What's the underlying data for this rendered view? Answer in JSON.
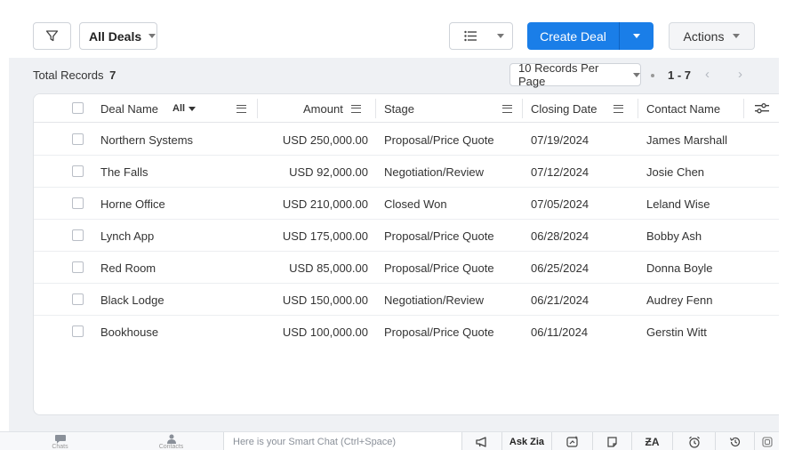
{
  "toolbar": {
    "filter_icon": "filter-icon",
    "view_label": "All Deals",
    "list_view_icon": "list-view-icon",
    "create_label": "Create Deal",
    "actions_label": "Actions"
  },
  "records": {
    "total_label": "Total Records",
    "total_count": "7",
    "per_page": "10 Records Per Page",
    "range": "1 - 7",
    "prev": "‹",
    "next": "›"
  },
  "table": {
    "columns": {
      "deal_name": "Deal Name",
      "deal_filter": "All",
      "amount": "Amount",
      "stage": "Stage",
      "closing_date": "Closing Date",
      "contact_name": "Contact Name"
    },
    "rows": [
      {
        "deal": "Northern Systems",
        "amount": "USD 250,000.00",
        "stage": "Proposal/Price Quote",
        "date": "07/19/2024",
        "contact": "James Marshall"
      },
      {
        "deal": "The Falls",
        "amount": "USD 92,000.00",
        "stage": "Negotiation/Review",
        "date": "07/12/2024",
        "contact": "Josie Chen"
      },
      {
        "deal": "Horne Office",
        "amount": "USD 210,000.00",
        "stage": "Closed Won",
        "date": "07/05/2024",
        "contact": "Leland Wise"
      },
      {
        "deal": "Lynch App",
        "amount": "USD 175,000.00",
        "stage": "Proposal/Price Quote",
        "date": "06/28/2024",
        "contact": "Bobby Ash"
      },
      {
        "deal": "Red Room",
        "amount": "USD 85,000.00",
        "stage": "Proposal/Price Quote",
        "date": "06/25/2024",
        "contact": "Donna Boyle"
      },
      {
        "deal": "Black Lodge",
        "amount": "USD 150,000.00",
        "stage": "Negotiation/Review",
        "date": "06/21/2024",
        "contact": "Audrey Fenn"
      },
      {
        "deal": "Bookhouse",
        "amount": "USD 100,000.00",
        "stage": "Proposal/Price Quote",
        "date": "06/11/2024",
        "contact": "Gerstin Witt"
      }
    ]
  },
  "bottombar": {
    "chats_label": "Chats",
    "contacts_label": "Contacts",
    "smart_chat_placeholder": "Here is your Smart Chat (Ctrl+Space)",
    "ask_zia": "Ask Zia"
  },
  "colors": {
    "accent": "#1a7ee8",
    "panel_bg": "#eff1f4"
  }
}
